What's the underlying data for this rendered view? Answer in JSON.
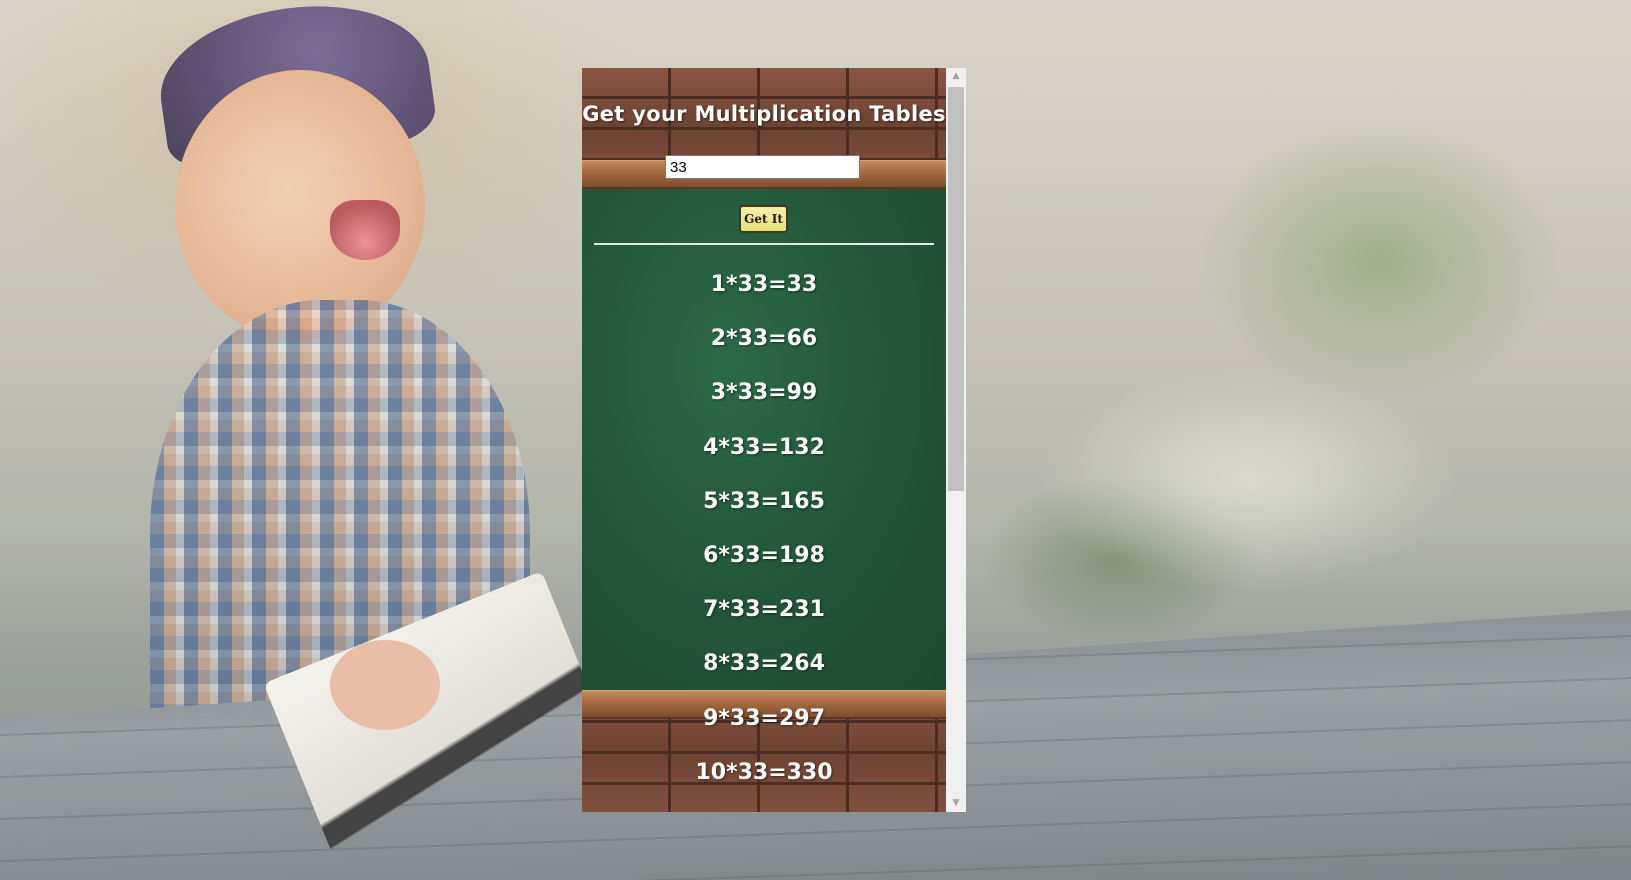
{
  "app": {
    "title": "Get your Multiplication Tables"
  },
  "form": {
    "input_value": "33",
    "button_label": "Get It"
  },
  "results": [
    "1*33=33",
    "2*33=66",
    "3*33=99",
    "4*33=132",
    "5*33=165",
    "6*33=198",
    "7*33=231",
    "8*33=264",
    "9*33=297",
    "10*33=330"
  ],
  "scrollbar": {
    "up_icon": "arrow-up-icon",
    "down_icon": "arrow-down-icon"
  },
  "colors": {
    "board": "#23583b",
    "brick": "#7a4a36",
    "button": "#e6df7c"
  }
}
